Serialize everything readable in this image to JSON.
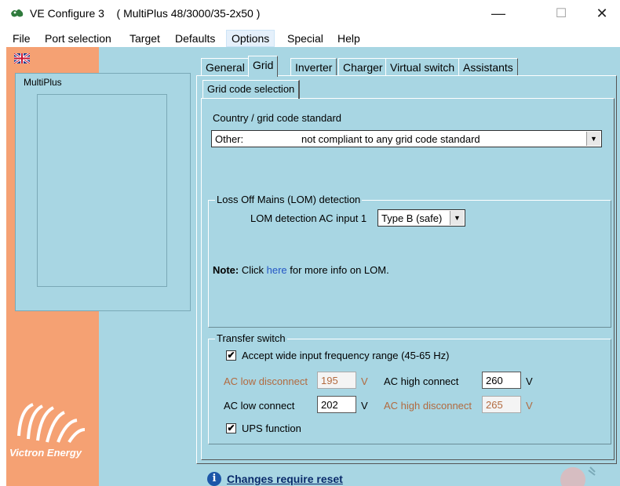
{
  "window": {
    "app_name": "VE Configure 3",
    "device_title": "( MultiPlus 48/3000/35-2x50 )",
    "minimize": "—",
    "maximize": "☐",
    "close": "✕"
  },
  "menu": [
    "File",
    "Port selection",
    "Target",
    "Defaults",
    "Options",
    "Special",
    "Help"
  ],
  "sidebar": {
    "device_label": "MultiPlus",
    "brand": "Victron Energy"
  },
  "tabs": [
    "General",
    "Grid",
    "Inverter",
    "Charger",
    "Virtual switch",
    "Assistants"
  ],
  "active_tab": "Grid",
  "subtab": "Grid code selection",
  "grid_code": {
    "label": "Country / grid code standard",
    "selected_left": "Other:",
    "selected_right": "not compliant to any grid code standard"
  },
  "lom": {
    "legend": "Loss Off Mains (LOM) detection",
    "input_label": "LOM detection AC input 1",
    "input_value": "Type B (safe)",
    "note_bold": "Note:",
    "note_pre": " Click ",
    "note_link": "here",
    "note_post": " for more info on LOM."
  },
  "transfer": {
    "legend": "Transfer switch",
    "wide_freq_label": "Accept wide input frequency range (45-65 Hz)",
    "wide_freq_checked": true,
    "ac_low_disconnect_label": "AC low disconnect",
    "ac_low_disconnect_value": "195",
    "ac_low_connect_label": "AC low connect",
    "ac_low_connect_value": "202",
    "ac_high_connect_label": "AC high connect",
    "ac_high_connect_value": "260",
    "ac_high_disconnect_label": "AC high disconnect",
    "ac_high_disconnect_value": "265",
    "unit": "V",
    "ups_label": "UPS function",
    "ups_checked": true
  },
  "footer": {
    "reset_text": "Changes require reset",
    "info_glyph": "i"
  },
  "colors": {
    "workspace": "#a8d6e3",
    "sidebar": "#f5a173",
    "disabled_text": "#b26a3f",
    "link": "#2456c5"
  }
}
